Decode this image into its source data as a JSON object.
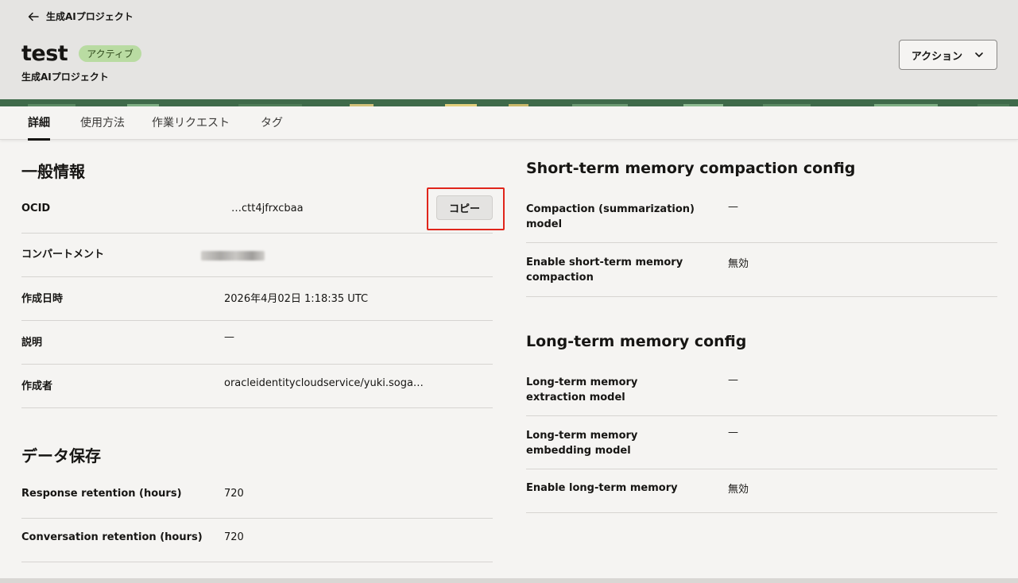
{
  "header": {
    "back_label": "生成AIプロジェクト",
    "title": "test",
    "status_badge": "アクティブ",
    "subtitle": "生成AIプロジェクト",
    "action_label": "アクション"
  },
  "tabs": [
    {
      "label": "詳細",
      "active": true
    },
    {
      "label": "使用方法",
      "active": false
    },
    {
      "label": "作業リクエスト",
      "active": false
    },
    {
      "label": "タグ",
      "active": false
    }
  ],
  "general": {
    "title": "一般情報",
    "rows": [
      {
        "label": "OCID",
        "value": "…ctt4jfrxcbaa"
      },
      {
        "label": "コンパートメント",
        "value": ""
      },
      {
        "label": "作成日時",
        "value": "2026年4月02日 1:18:35 UTC"
      },
      {
        "label": "説明",
        "value": "—"
      },
      {
        "label": "作成者",
        "value": "oracleidentitycloudservice/yuki.soga…"
      }
    ],
    "copy_label": "コピー"
  },
  "data_retention": {
    "title": "データ保存",
    "rows": [
      {
        "label": "Response retention (hours)",
        "value": "720"
      },
      {
        "label": "Conversation retention (hours)",
        "value": "720"
      }
    ]
  },
  "short_term": {
    "title": "Short-term memory compaction config",
    "rows": [
      {
        "label": "Compaction (summarization) model",
        "value": "—"
      },
      {
        "label": "Enable short-term memory compaction",
        "value": "無効"
      }
    ]
  },
  "long_term": {
    "title": "Long-term memory config",
    "rows": [
      {
        "label": "Long-term memory extraction model",
        "value": "—"
      },
      {
        "label": "Long-term memory embedding model",
        "value": "—"
      },
      {
        "label": "Enable long-term memory",
        "value": "無効"
      }
    ]
  },
  "colors": {
    "badge_bg": "#b9dba2",
    "highlight": "#e0251b",
    "header_bg": "#e5e4e2"
  }
}
